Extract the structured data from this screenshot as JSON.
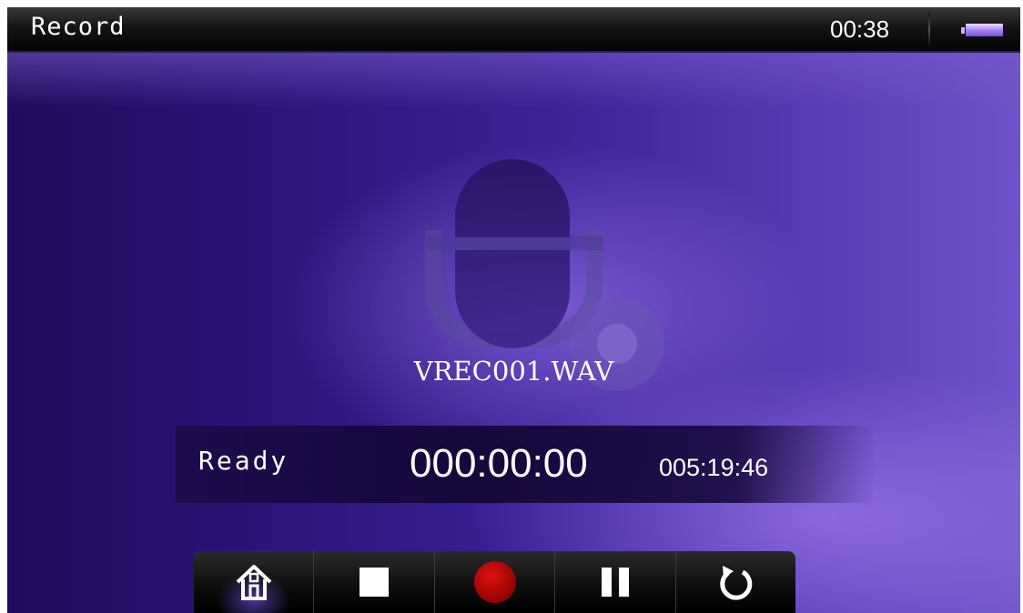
{
  "statusbar": {
    "title": "Record",
    "clock": "00:38",
    "battery_icon": "battery-icon"
  },
  "recording": {
    "filename": "VREC001.WAV",
    "status": "Ready",
    "elapsed": "000:00:00",
    "remaining": "005:19:46"
  },
  "controls": [
    {
      "name": "home",
      "icon": "home-icon"
    },
    {
      "name": "stop",
      "icon": "stop-icon"
    },
    {
      "name": "record",
      "icon": "record-icon"
    },
    {
      "name": "pause",
      "icon": "pause-icon"
    },
    {
      "name": "repeat",
      "icon": "repeat-icon"
    }
  ],
  "colors": {
    "accent": "#8a5cf0",
    "record": "#b00000",
    "background": "#2c1478"
  }
}
